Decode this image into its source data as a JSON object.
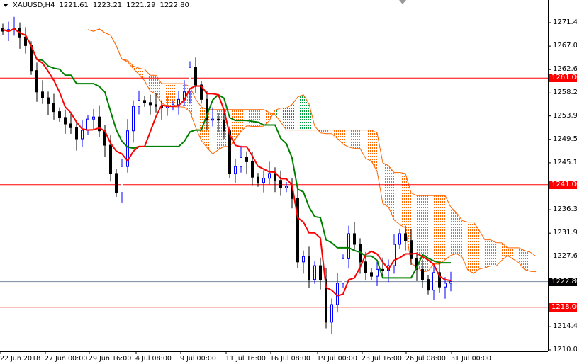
{
  "header": {
    "symbol": "XAUUSD,H4",
    "open": "1221.61",
    "high": "1223.21",
    "low": "1221.29",
    "close": "1222.80"
  },
  "chart_data": {
    "type": "candlestick",
    "title": "XAUUSD,H4",
    "indicators": [
      "Ichimoku Kinko Hyo (Tenkan-sen red, Kijun-sen green, Kumo cloud)"
    ],
    "ylim": [
      1210.0,
      1273.5
    ],
    "y_ticks": [
      "1271.40",
      "1267.00",
      "1262.60",
      "1258.20",
      "1253.90",
      "1249.50",
      "1245.10",
      "1236.30",
      "1231.90",
      "1227.60",
      "1214.40",
      "1210.00"
    ],
    "x_ticks": [
      "22 Jun 2018",
      "27 Jun 00:00",
      "29 Jun 16:00",
      "4 Jul 08:00",
      "9 Jul 00:00",
      "11 Jul 16:00",
      "16 Jul 08:00",
      "19 Jul 00:00",
      "23 Jul 16:00",
      "26 Jul 08:00",
      "31 Jul 00:00"
    ],
    "closes": [
      1269.8,
      1270.1,
      1270.3,
      1268.7,
      1267.1,
      1262.4,
      1258.4,
      1257.3,
      1256.2,
      1254.7,
      1253.6,
      1252.4,
      1251.7,
      1249.6,
      1251.2,
      1253.3,
      1253.7,
      1251.1,
      1248.4,
      1243.1,
      1239.5,
      1244.4,
      1251.1,
      1255.7,
      1256.8,
      1256.4,
      1256.0,
      1255.7,
      1255.4,
      1255.7,
      1256.0,
      1257.0,
      1258.4,
      1263.0,
      1259.7,
      1257.0,
      1253.1,
      1253.3,
      1253.1,
      1251.1,
      1243.1,
      1244.4,
      1246.1,
      1245.3,
      1242.4,
      1241.4,
      1242.2,
      1243.1,
      1241.8,
      1240.4,
      1240.7,
      1238.4,
      1226.5,
      1227.5,
      1223.2,
      1225.8,
      1223.2,
      1215.2,
      1218.5,
      1222.5,
      1227.1,
      1231.8,
      1229.8,
      1226.5,
      1224.5,
      1223.8,
      1225.1,
      1224.9,
      1225.8,
      1229.8,
      1231.8,
      1230.5,
      1227.1,
      1225.1,
      1223.2,
      1221.2,
      1224.5,
      1221.8,
      1222.5,
      1222.8
    ],
    "horizontal_levels": [
      {
        "price": 1261.0,
        "label": "1261.00",
        "color": "#ff0000"
      },
      {
        "price": 1241.0,
        "label": "1241.00",
        "color": "#ff0000"
      },
      {
        "price": 1218.0,
        "label": "1218.00",
        "color": "#ff0000"
      }
    ],
    "bid": {
      "price": 1222.8,
      "label": "1222.80",
      "color": "#000000"
    }
  },
  "colors": {
    "tenkan": "#ff0000",
    "kijun": "#008000",
    "cloud_bear": "#ff6600",
    "cloud_bull": "#00a040",
    "bull_candle": "#0000ff",
    "bear_candle": "#000000"
  }
}
